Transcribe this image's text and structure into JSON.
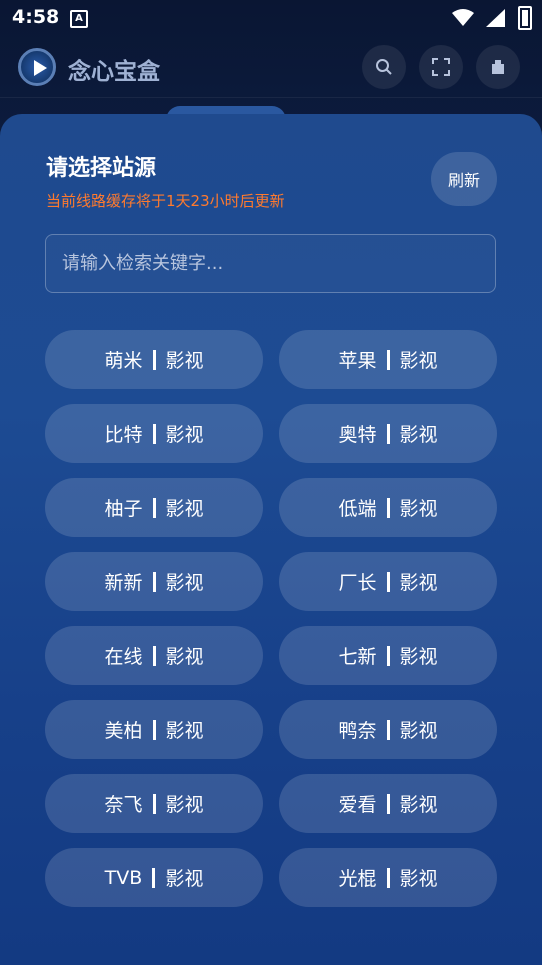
{
  "status_bar": {
    "time": "4:58",
    "badge": "A"
  },
  "app": {
    "title": "念心宝盒"
  },
  "modal": {
    "title": "请选择站源",
    "subtitle": "当前线路缓存将于1天23小时后更新",
    "refresh_label": "刷新",
    "search_placeholder": "请输入检索关键字...",
    "sources": [
      {
        "name": "萌米",
        "type": "影视"
      },
      {
        "name": "苹果",
        "type": "影视"
      },
      {
        "name": "比特",
        "type": "影视"
      },
      {
        "name": "奥特",
        "type": "影视"
      },
      {
        "name": "柚子",
        "type": "影视"
      },
      {
        "name": "低端",
        "type": "影视"
      },
      {
        "name": "新新",
        "type": "影视"
      },
      {
        "name": "厂长",
        "type": "影视"
      },
      {
        "name": "在线",
        "type": "影视"
      },
      {
        "name": "七新",
        "type": "影视"
      },
      {
        "name": "美柏",
        "type": "影视"
      },
      {
        "name": "鸭奈",
        "type": "影视"
      },
      {
        "name": "奈飞",
        "type": "影视"
      },
      {
        "name": "爱看",
        "type": "影视"
      },
      {
        "name": "TVB ",
        "type": "影视"
      },
      {
        "name": "光棍",
        "type": "影视"
      }
    ]
  },
  "icons": {
    "search": "search-icon",
    "scan": "scan-icon",
    "home": "building-icon"
  }
}
